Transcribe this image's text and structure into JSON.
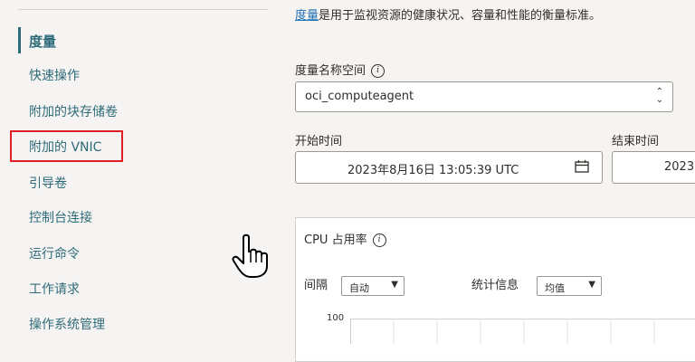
{
  "sidebar": {
    "items": [
      {
        "label": "度量",
        "active": true
      },
      {
        "label": "快速操作"
      },
      {
        "label": "附加的块存储卷"
      },
      {
        "label": "附加的 VNIC",
        "highlighted": true
      },
      {
        "label": "引导卷"
      },
      {
        "label": "控制台连接"
      },
      {
        "label": "运行命令"
      },
      {
        "label": "工作请求"
      },
      {
        "label": "操作系统管理"
      }
    ]
  },
  "main": {
    "intro_link": "度量",
    "intro_text": "是用于监视资源的健康状况、容量和性能的衡量标准。",
    "namespace_label": "度量名称空间",
    "namespace_value": "oci_computeagent",
    "start_label": "开始时间",
    "start_value": "2023年8月16日 13:05:39 UTC",
    "end_label": "结束时间",
    "end_value": "2023",
    "chart_title": "CPU 占用率",
    "interval_label": "间隔",
    "interval_value": "自动",
    "stat_label": "统计信息",
    "stat_value": "均值",
    "y_tick": "100"
  },
  "colors": {
    "link": "#1f6fb5",
    "nav": "#2e6b7a",
    "highlight": "#e01e25"
  },
  "icons": {
    "info": "info-icon",
    "calendar": "calendar-icon",
    "cursor": "hand-pointer-cursor"
  }
}
